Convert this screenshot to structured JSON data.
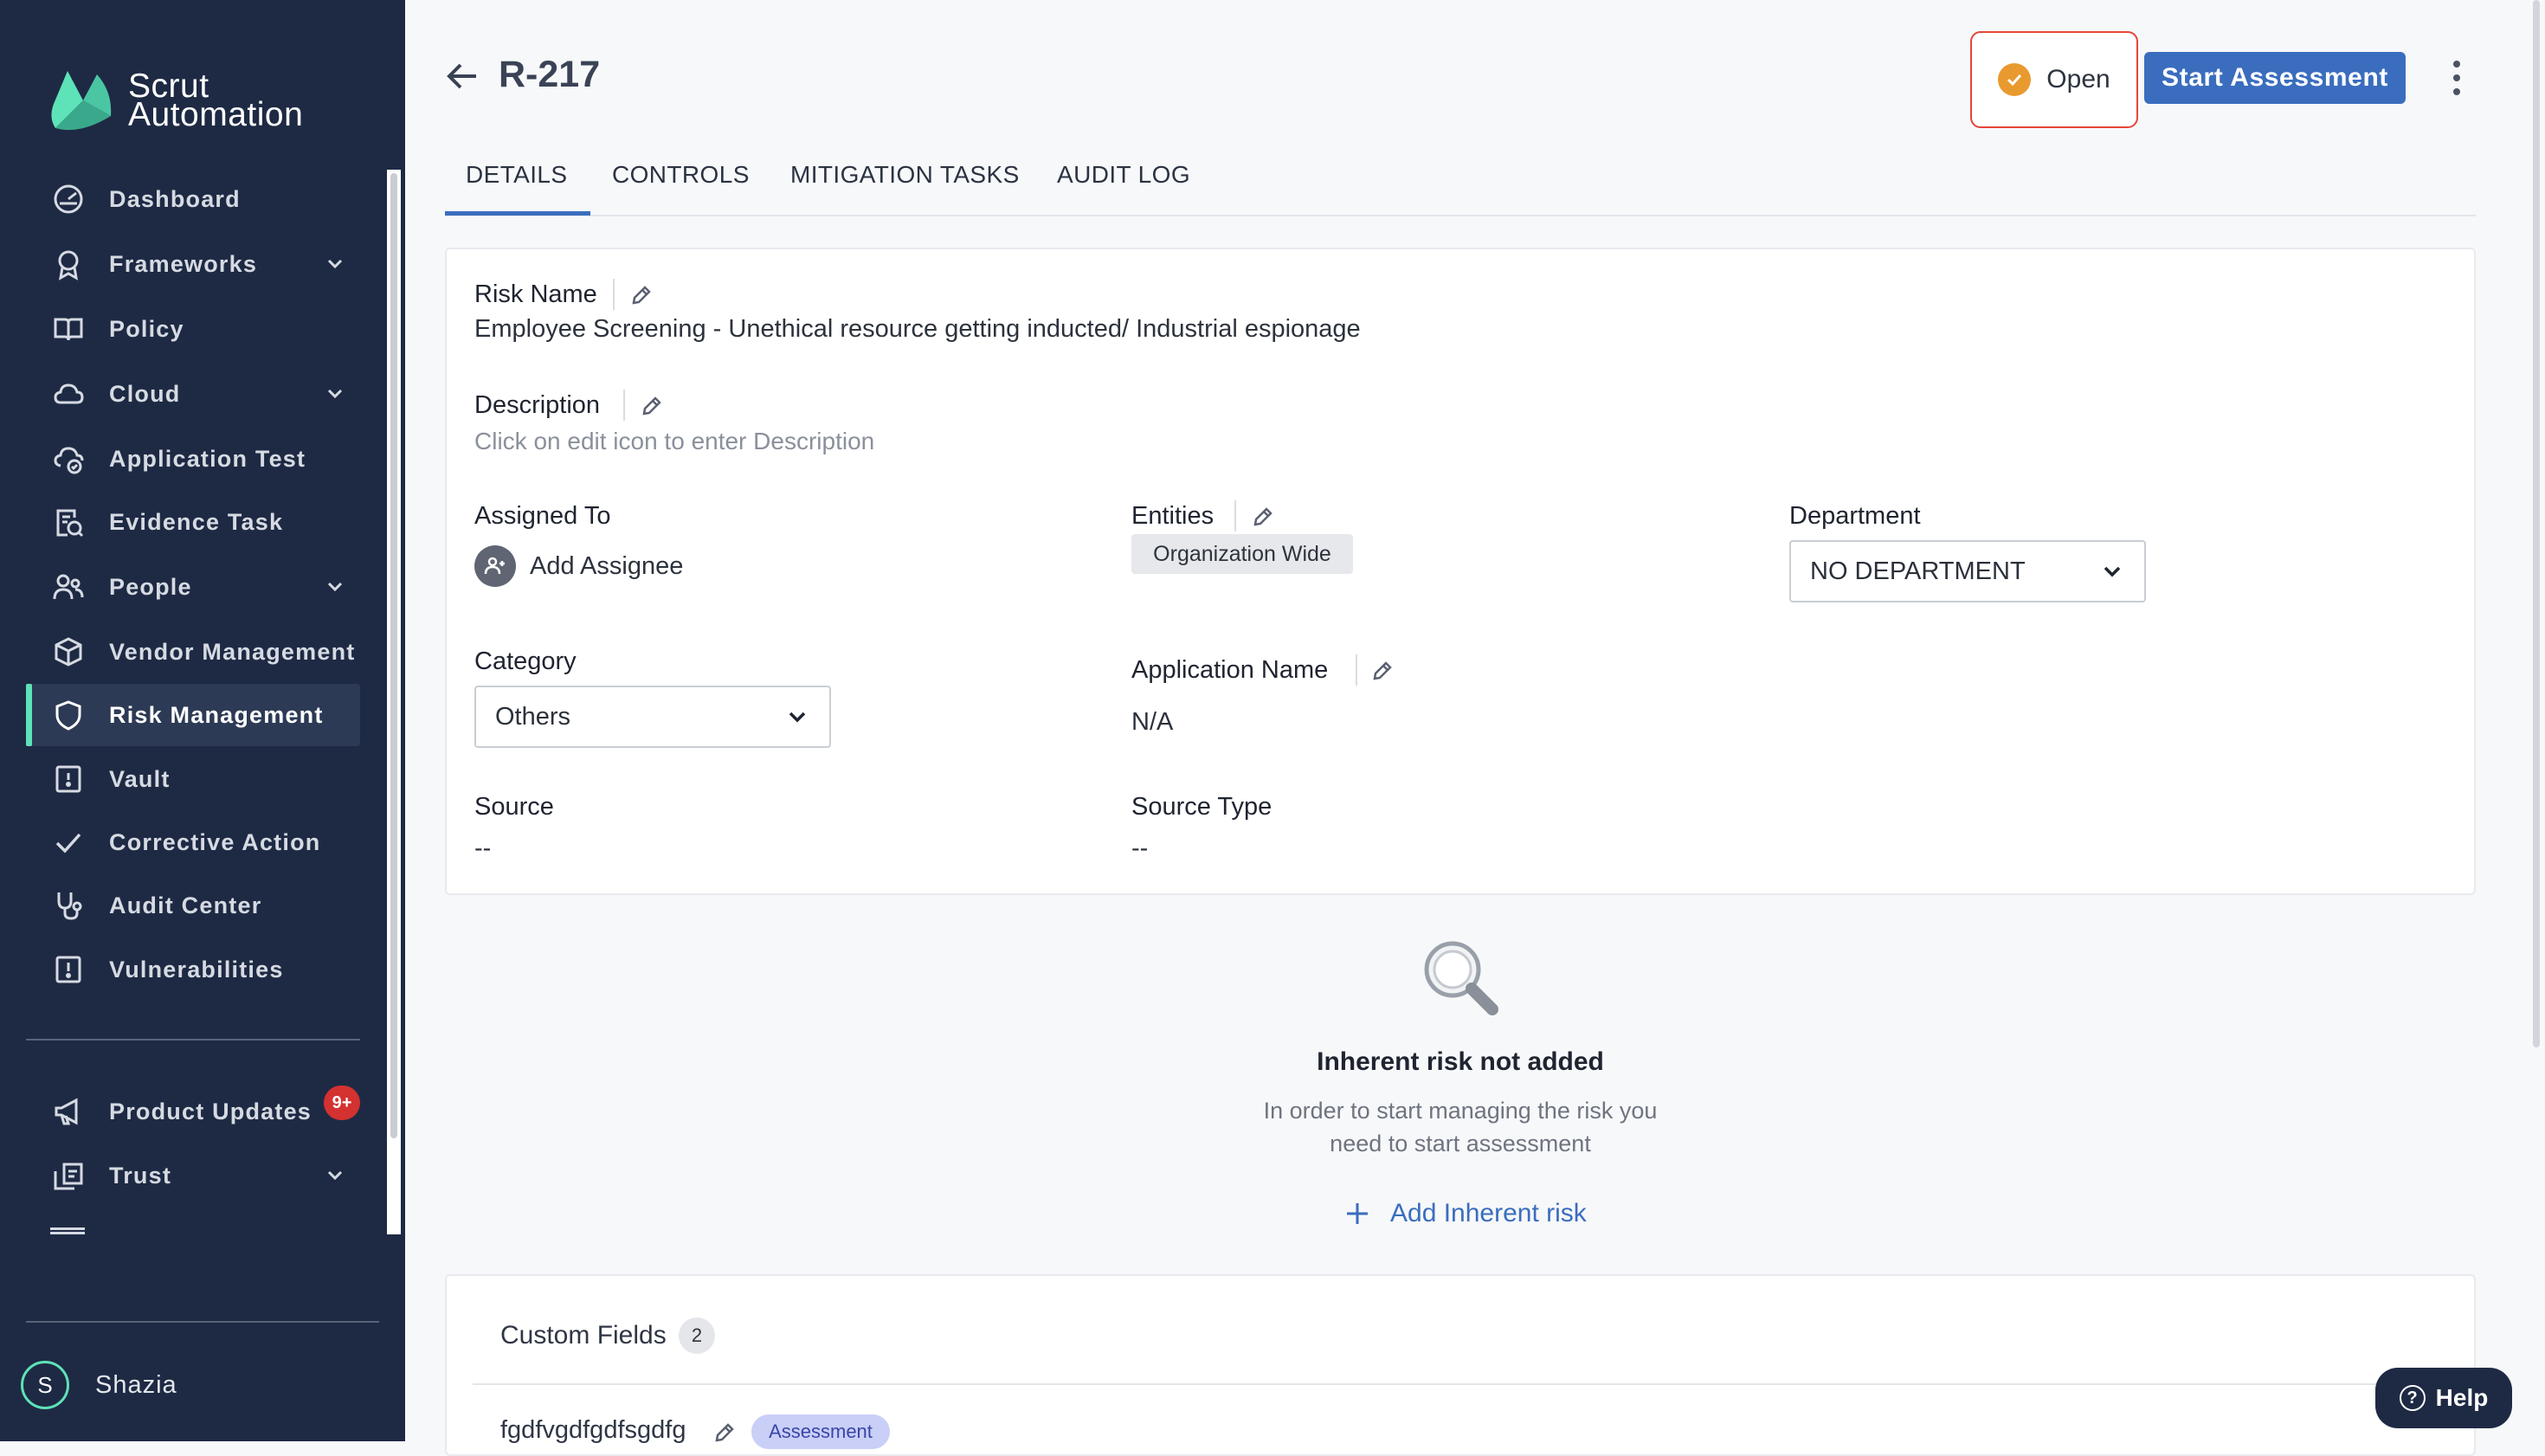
{
  "brand": {
    "line1": "Scrut",
    "line2": "Automation"
  },
  "sidebar": {
    "items": [
      {
        "label": "Dashboard",
        "icon": "dashboard-icon"
      },
      {
        "label": "Frameworks",
        "icon": "frameworks-icon",
        "expandable": true
      },
      {
        "label": "Policy",
        "icon": "book-icon"
      },
      {
        "label": "Cloud",
        "icon": "cloud-icon",
        "expandable": true
      },
      {
        "label": "Application Test",
        "icon": "cloud-check-icon"
      },
      {
        "label": "Evidence Task",
        "icon": "evidence-icon"
      },
      {
        "label": "People",
        "icon": "people-icon",
        "expandable": true
      },
      {
        "label": "Vendor Management",
        "icon": "cube-icon"
      },
      {
        "label": "Risk Management",
        "icon": "shield-icon",
        "active": true
      },
      {
        "label": "Vault",
        "icon": "vault-icon"
      },
      {
        "label": "Corrective Action",
        "icon": "checkmark-icon"
      },
      {
        "label": "Audit Center",
        "icon": "stethoscope-icon"
      },
      {
        "label": "Vulnerabilities",
        "icon": "alert-box-icon"
      }
    ],
    "bottom_items": [
      {
        "label": "Product Updates",
        "icon": "megaphone-icon",
        "badge": "9+"
      },
      {
        "label": "Trust",
        "icon": "trust-icon",
        "expandable": true
      }
    ],
    "user": {
      "initial": "S",
      "name": "Shazia"
    }
  },
  "header": {
    "title": "R-217",
    "status": "Open",
    "primary_action": "Start Assessment"
  },
  "tabs": [
    "DETAILS",
    "CONTROLS",
    "MITIGATION TASKS",
    "AUDIT LOG"
  ],
  "details": {
    "risk_name_label": "Risk Name",
    "risk_name": "Employee Screening - Unethical resource getting inducted/ Industrial espionage",
    "description_label": "Description",
    "description_placeholder": "Click on edit icon to enter Description",
    "assigned_to_label": "Assigned To",
    "add_assignee": "Add Assignee",
    "entities_label": "Entities",
    "entity_tag": "Organization Wide",
    "department_label": "Department",
    "department_value": "NO DEPARTMENT",
    "category_label": "Category",
    "category_value": "Others",
    "app_name_label": "Application Name",
    "app_name_value": "N/A",
    "source_label": "Source",
    "source_value": "--",
    "source_type_label": "Source Type",
    "source_type_value": "--"
  },
  "inherent": {
    "title": "Inherent risk not added",
    "desc_line1": "In order to start managing the risk you",
    "desc_line2": "need to start assessment",
    "action": "Add Inherent risk"
  },
  "custom_fields": {
    "title": "Custom Fields",
    "count": "2",
    "field_name": "fgdfvgdfgdfsgdfg",
    "field_tag": "Assessment"
  },
  "help": {
    "label": "Help",
    "glyph": "?"
  },
  "colors": {
    "sidebar_bg": "#1e2a44",
    "accent": "#3a6dbe",
    "status": "#e99a2e",
    "active_marker": "#5ee2b8"
  }
}
